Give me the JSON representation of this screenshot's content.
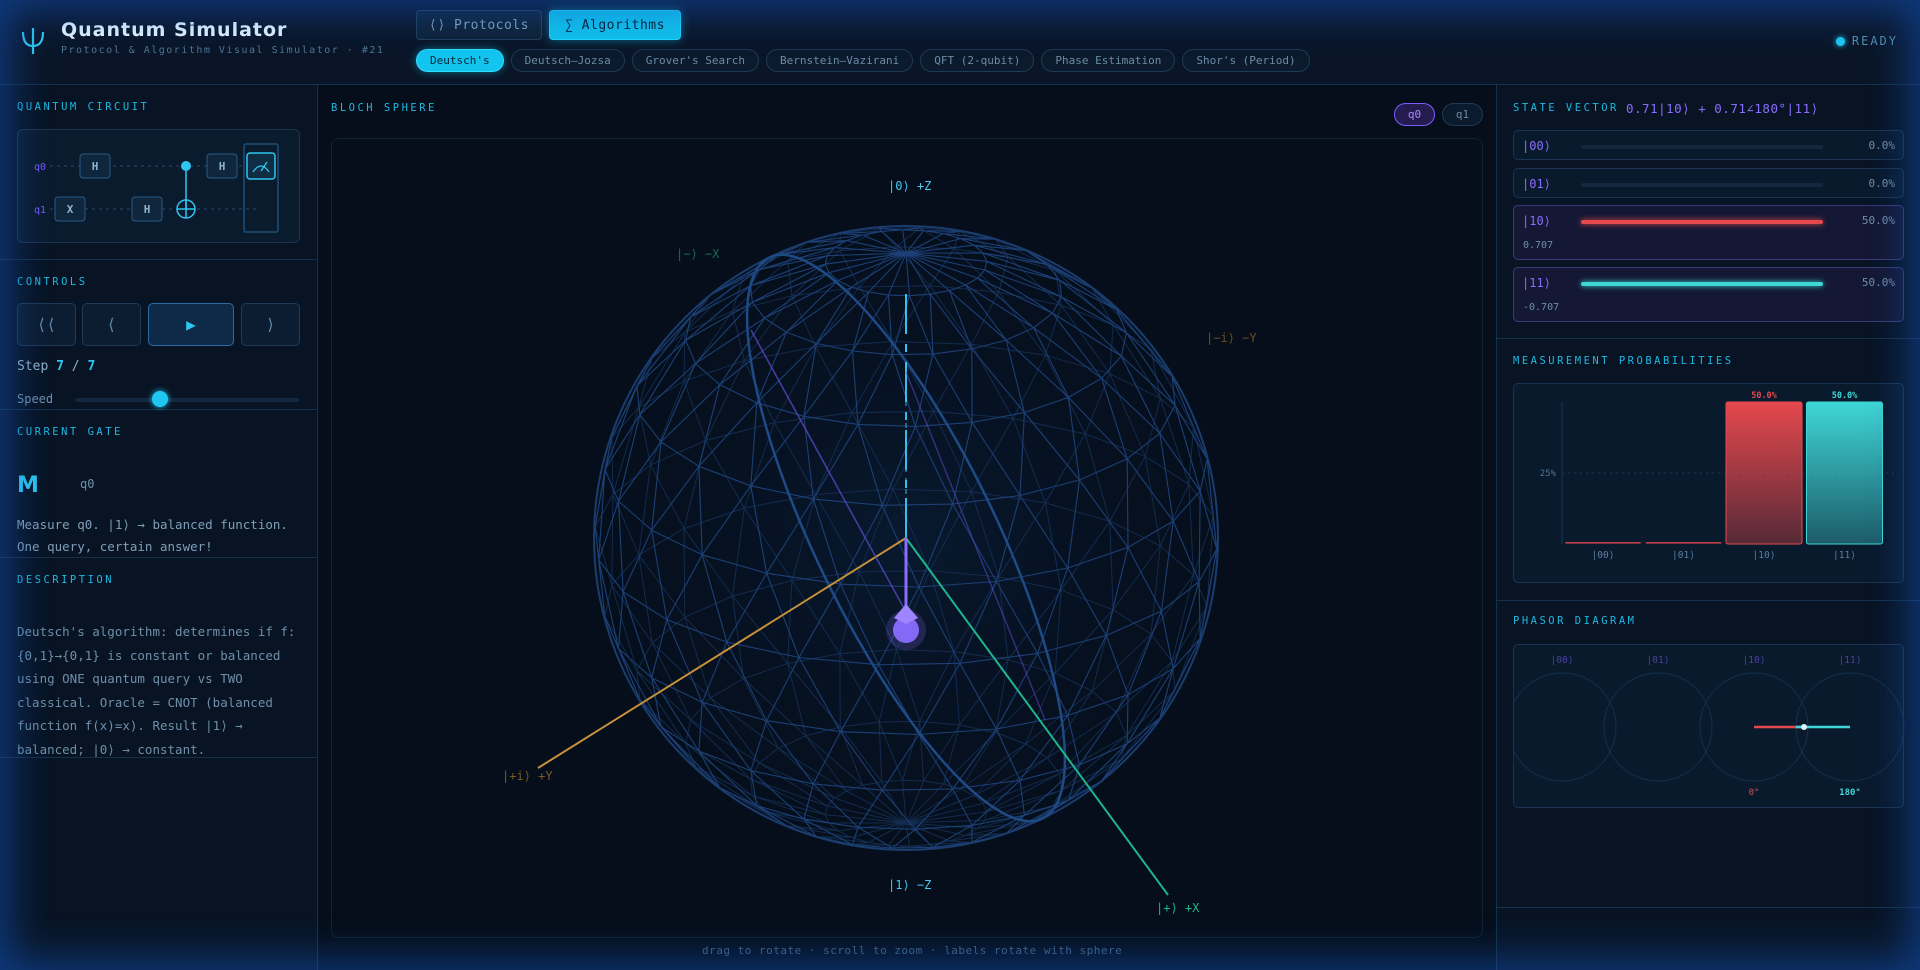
{
  "app": {
    "title": "Quantum Simulator",
    "subtitle": "Protocol & Algorithm Visual Simulator  ·  #21",
    "status": "READY"
  },
  "modes": {
    "protocols": "⟨⟩ Protocols",
    "algorithms": "∑ Algorithms",
    "active": "algorithms"
  },
  "algorithms": [
    "Deutsch's",
    "Deutsch–Jozsa",
    "Grover's Search",
    "Bernstein–Vazirani",
    "QFT (2-qubit)",
    "Phase Estimation",
    "Shor's (Period)"
  ],
  "left": {
    "circuit_title": "QUANTUM CIRCUIT",
    "circuit": {
      "q0_label": "q0",
      "q1_label": "q1",
      "q0_gates": [
        "H",
        "H"
      ],
      "q1_gates": [
        "X",
        "H"
      ]
    },
    "controls_title": "CONTROLS",
    "controls": {
      "first": "⟨⟨",
      "prev": "⟨",
      "play": "▶",
      "next": "⟩"
    },
    "step_label": "Step",
    "step_current": "7",
    "step_sep": "/",
    "step_total": "7",
    "speed_label": "Speed",
    "speed_value": 0.38,
    "gate_title": "CURRENT GATE",
    "gate_symbol": "M",
    "gate_target": "q0",
    "gate_text": "Measure q0. |1⟩ → balanced function. One query, certain answer!",
    "description_title": "DESCRIPTION",
    "description": "Deutsch's algorithm: determines if f:{0,1}→{0,1} is constant or balanced using ONE quantum query vs TWO classical. Oracle = CNOT (balanced function f(x)=x). Result |1⟩ → balanced; |0⟩ → constant."
  },
  "center": {
    "title": "BLOCH SPHERE",
    "qubit_tabs": [
      "q0",
      "q1"
    ],
    "active_qubit": "q0",
    "axis_labels": {
      "z0": "|0⟩ +Z",
      "z1": "|1⟩ −Z",
      "mx": "|−⟩ −X",
      "px": "|+⟩ +X",
      "my": "|−i⟩ −Y",
      "py": "|+i⟩ +Y"
    },
    "hint": "drag to rotate · scroll to zoom · labels rotate with sphere"
  },
  "right": {
    "state_title": "STATE VECTOR",
    "state_formula": "0.71|10⟩ + 0.71∠180°|11⟩",
    "amplitudes": [
      {
        "ket": "|00⟩",
        "pct": "0.0%",
        "fraction": 0,
        "value": "",
        "color": "#8a6cff"
      },
      {
        "ket": "|01⟩",
        "pct": "0.0%",
        "fraction": 0,
        "value": "",
        "color": "#8a6cff"
      },
      {
        "ket": "|10⟩",
        "pct": "50.0%",
        "fraction": 1.0,
        "value": "0.707",
        "color": "#e5484d"
      },
      {
        "ket": "|11⟩",
        "pct": "50.0%",
        "fraction": 1.0,
        "value": "-0.707",
        "color": "#3fd6d6"
      }
    ],
    "prob_title": "MEASUREMENT PROBABILITIES",
    "phasor_title": "PHASOR DIAGRAM",
    "phasor": {
      "kets": [
        "|00⟩",
        "|01⟩",
        "|10⟩",
        "|11⟩"
      ],
      "angle_labels": [
        "0°",
        "180°"
      ]
    }
  },
  "chart_data": {
    "type": "bar",
    "categories": [
      "|00⟩",
      "|01⟩",
      "|10⟩",
      "|11⟩"
    ],
    "values": [
      0,
      0,
      50,
      50
    ],
    "data_labels": [
      "",
      "",
      "50.0%",
      "50.0%"
    ],
    "ytick": "25%",
    "ylim": [
      0,
      50
    ],
    "colors": [
      "#e5484d",
      "#e5484d",
      "#e5484d",
      "#3fd6d6"
    ]
  }
}
